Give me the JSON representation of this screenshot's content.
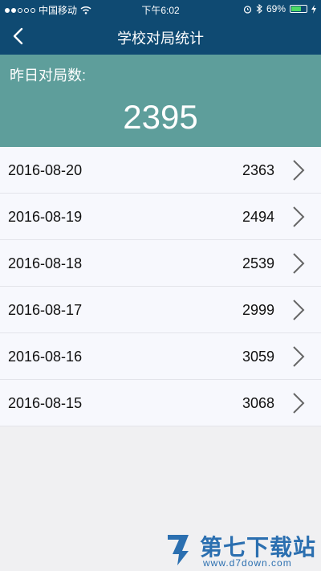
{
  "status_bar": {
    "carrier": "中国移动",
    "time": "下午6:02",
    "battery_percent": "69%",
    "battery_level": 0.69
  },
  "nav": {
    "title": "学校对局统计",
    "back_icon": "chevron-left-icon"
  },
  "summary": {
    "label": "昨日对局数:",
    "value": "2395"
  },
  "rows": [
    {
      "date": "2016-08-20",
      "count": "2363"
    },
    {
      "date": "2016-08-19",
      "count": "2494"
    },
    {
      "date": "2016-08-18",
      "count": "2539"
    },
    {
      "date": "2016-08-17",
      "count": "2999"
    },
    {
      "date": "2016-08-16",
      "count": "3059"
    },
    {
      "date": "2016-08-15",
      "count": "3068"
    }
  ],
  "watermark": {
    "name": "第七下载站",
    "url": "www.d7down.com"
  },
  "colors": {
    "nav_bg": "#0f4a72",
    "summary_bg": "#5e9e9b",
    "list_bg": "#f7f8fd",
    "page_bg": "#f0f0f2",
    "watermark": "#2b6fb0"
  }
}
